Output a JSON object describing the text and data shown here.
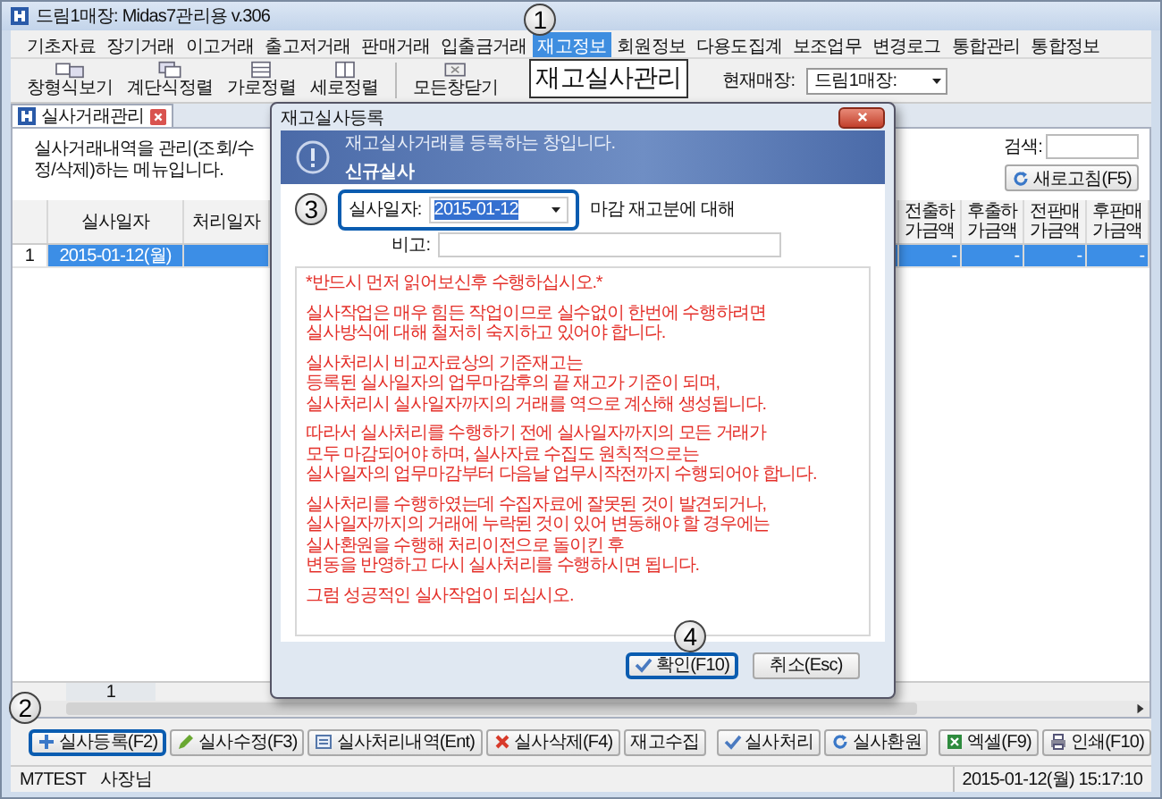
{
  "window": {
    "title": "드림1매장: Midas7관리용 v.306"
  },
  "menu": [
    {
      "label": "기초자료",
      "selected": false
    },
    {
      "label": "장기거래",
      "selected": false
    },
    {
      "label": "이고거래",
      "selected": false
    },
    {
      "label": "출고저거래",
      "selected": false
    },
    {
      "label": "판매거래",
      "selected": false
    },
    {
      "label": "입출금거래",
      "selected": false
    },
    {
      "label": "재고정보",
      "selected": true
    },
    {
      "label": "회원정보",
      "selected": false
    },
    {
      "label": "다용도집계",
      "selected": false
    },
    {
      "label": "보조업무",
      "selected": false
    },
    {
      "label": "변경로그",
      "selected": false
    },
    {
      "label": "통합관리",
      "selected": false
    },
    {
      "label": "통합정보",
      "selected": false
    }
  ],
  "menu_popup": {
    "label": "재고실사관리"
  },
  "toolbar": [
    {
      "label": "창형식보기",
      "kind": "windows"
    },
    {
      "label": "계단식정렬",
      "kind": "cascade"
    },
    {
      "label": "가로정렬",
      "kind": "rows"
    },
    {
      "label": "세로정렬",
      "kind": "columns"
    },
    {
      "label": "모든창닫기",
      "kind": "close"
    }
  ],
  "store": {
    "label": "현재매장:",
    "value": "드림1매장:"
  },
  "tabs": [
    {
      "label": "실사거래관리",
      "selected": true
    }
  ],
  "description": "실사거래내역을 관리(조회/수정/삭제)하는 메뉴입니다.",
  "search": {
    "label": "검색:"
  },
  "refresh_button": "새로고침(F5)",
  "table": {
    "left_columns": [
      "실사일자",
      "처리일자"
    ],
    "right_columns": [
      "전출하가금액",
      "후출하가금액",
      "전판매가금액",
      "후판매가금액"
    ],
    "rows": [
      {
        "number": "1",
        "date": "2015-01-12(월)",
        "selected": true,
        "right": [
          "-",
          "-",
          "-",
          "-"
        ]
      }
    ]
  },
  "footer_row": "1",
  "dialog": {
    "title": "재고실사등록",
    "banner_text": "재고실사거래를 등록하는 창입니다.",
    "banner_subtitle": "신규실사",
    "date_label": "실사일자:",
    "date_value": "2015-01-12",
    "date_highlighted": true,
    "date_suffix": "마감 재고분에 대해",
    "remark_label": "비고:",
    "notice": [
      [
        "*반드시 먼저 읽어보신후 수행하십시오.*"
      ],
      [
        "실사작업은 매우 힘든 작업이므로 실수없이 한번에 수행하려면",
        "실사방식에 대해 철저히 숙지하고 있어야 합니다."
      ],
      [
        "실사처리시 비교자료상의 기준재고는",
        "등록된 실사일자의 업무마감후의 끝 재고가 기준이 되며,",
        "실사처리시 실사일자까지의 거래를 역으로 계산해 생성됩니다."
      ],
      [
        "따라서 실사처리를 수행하기 전에 실사일자까지의 모든 거래가",
        "모두 마감되어야 하며, 실사자료 수집도 원칙적으로는",
        "실사일자의 업무마감부터 다음날 업무시작전까지 수행되어야 합니다."
      ],
      [
        "실사처리를 수행하였는데 수집자료에 잘못된 것이 발견되거나,",
        "실사일자까지의 거래에 누락된 것이 있어 변동해야 할 경우에는",
        "실사환원을 수행해 처리이전으로 돌이킨 후",
        "변동을 반영하고 다시 실사처리를 수행하시면 됩니다."
      ],
      [
        "그럼 성공적인 실사작업이 되십시오."
      ]
    ],
    "buttons": [
      {
        "label": "확인(F10)",
        "kind": "confirm",
        "highlighted": true
      },
      {
        "label": "취소(Esc)",
        "kind": "plain",
        "highlighted": false
      }
    ]
  },
  "buttons": [
    {
      "label": "실사등록(F2)",
      "kind": "add",
      "highlighted": true
    },
    {
      "label": "실사수정(F3)",
      "kind": "edit",
      "highlighted": false
    },
    {
      "label": "실사처리내역(Ent)",
      "kind": "list",
      "highlighted": false
    },
    {
      "label": "실사삭제(F4)",
      "kind": "delete",
      "highlighted": false
    },
    {
      "label": "재고수집",
      "kind": "plain",
      "highlighted": false
    },
    {
      "label": "실사처리",
      "kind": "confirm",
      "highlighted": false
    },
    {
      "label": "실사환원",
      "kind": "refresh",
      "highlighted": false
    },
    {
      "label": "엑셀(F9)",
      "kind": "excel",
      "highlighted": false
    },
    {
      "label": "인쇄(F10)",
      "kind": "print",
      "highlighted": false
    }
  ],
  "status_bar": {
    "user": "M7TEST",
    "role": "사장님",
    "datetime": "2015-01-12(월) 15:17:10"
  },
  "markers": [
    "1",
    "2",
    "3",
    "4"
  ]
}
